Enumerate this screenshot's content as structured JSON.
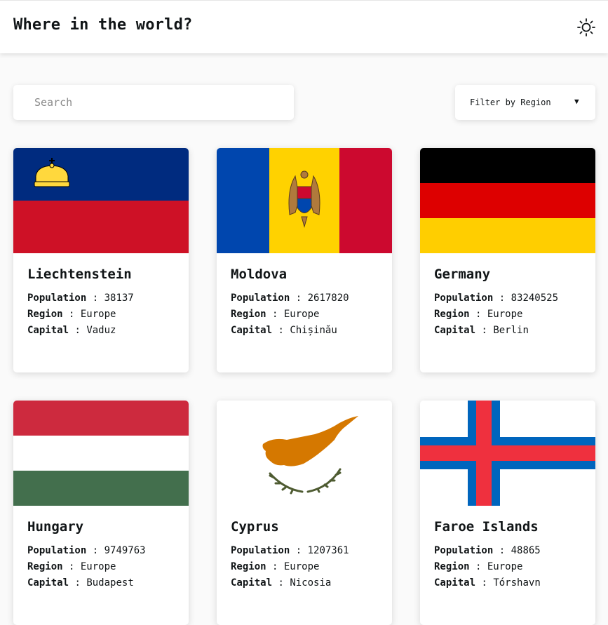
{
  "header": {
    "title": "Where in the world?",
    "theme_icon": "sun-icon"
  },
  "search": {
    "placeholder": "Search"
  },
  "filter": {
    "label": "Filter by Region",
    "caret_icon": "caret-down-icon"
  },
  "labels": {
    "population": "Population",
    "region": "Region",
    "capital": "Capital",
    "separator": " : "
  },
  "countries": [
    {
      "name": "Liechtenstein",
      "population": "38137",
      "region": "Europe",
      "capital": "Vaduz",
      "flag_icon": "flag-liechtenstein-icon",
      "colors": [
        "#002b7f",
        "#ce1126",
        "#ffd83d"
      ]
    },
    {
      "name": "Moldova",
      "population": "2617820",
      "region": "Europe",
      "capital": "Chișinău",
      "flag_icon": "flag-moldova-icon",
      "colors": [
        "#0046ae",
        "#ffd200",
        "#cc092f"
      ]
    },
    {
      "name": "Germany",
      "population": "83240525",
      "region": "Europe",
      "capital": "Berlin",
      "flag_icon": "flag-germany-icon",
      "colors": [
        "#000000",
        "#dd0000",
        "#ffce00"
      ]
    },
    {
      "name": "Hungary",
      "population": "9749763",
      "region": "Europe",
      "capital": "Budapest",
      "flag_icon": "flag-hungary-icon",
      "colors": [
        "#cd2a3e",
        "#ffffff",
        "#436f4d"
      ]
    },
    {
      "name": "Cyprus",
      "population": "1207361",
      "region": "Europe",
      "capital": "Nicosia",
      "flag_icon": "flag-cyprus-icon",
      "colors": [
        "#ffffff",
        "#d57800",
        "#4e5b31"
      ]
    },
    {
      "name": "Faroe Islands",
      "population": "48865",
      "region": "Europe",
      "capital": "Tórshavn",
      "flag_icon": "flag-faroe-islands-icon",
      "colors": [
        "#ffffff",
        "#0065bd",
        "#ef303e"
      ]
    }
  ]
}
